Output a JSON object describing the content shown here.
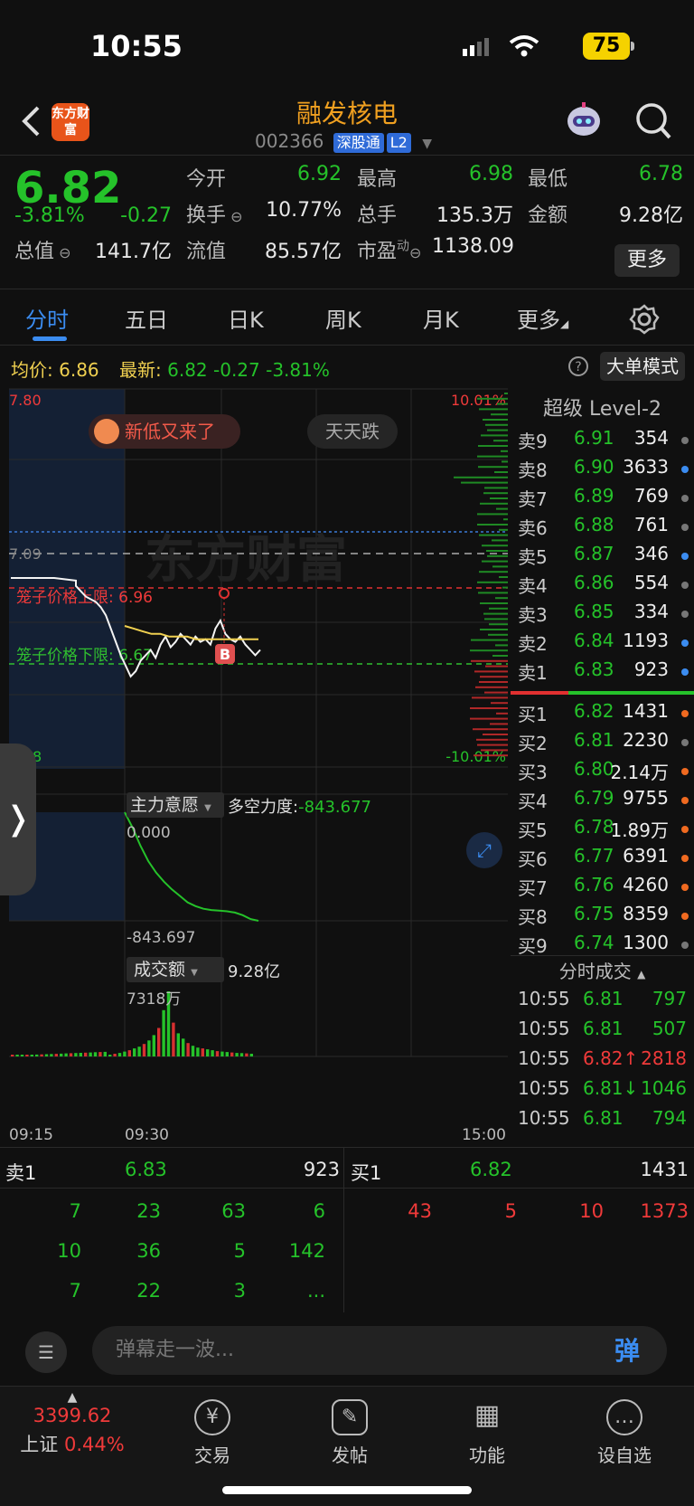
{
  "status_bar": {
    "time": "10:55",
    "battery": "75"
  },
  "header": {
    "logo_text": "东方财富",
    "stock_name": "融发核电",
    "stock_code": "002366",
    "tags": [
      "深股通",
      "L2"
    ]
  },
  "quote": {
    "price": "6.82",
    "change_pct": "-3.81%",
    "change": "-0.27",
    "rows": [
      [
        {
          "label": "今开",
          "value": "6.92",
          "color": "green"
        },
        {
          "label": "最高",
          "value": "6.98",
          "color": "green"
        },
        {
          "label": "最低",
          "value": "6.78",
          "color": "green"
        }
      ],
      [
        {
          "label": "换手",
          "value": "10.77%",
          "color": "white"
        },
        {
          "label": "总手",
          "value": "135.3万",
          "color": "white"
        },
        {
          "label": "金额",
          "value": "9.28亿",
          "color": "white"
        }
      ],
      [
        {
          "label": "总值",
          "value": "141.7亿",
          "color": "white"
        },
        {
          "label": "流值",
          "value": "85.57亿",
          "color": "white"
        },
        {
          "label": "市盈",
          "value": "1138.09",
          "color": "white"
        }
      ]
    ],
    "pe_superscript": "动",
    "more_label": "更多"
  },
  "tabs": [
    "分时",
    "五日",
    "日K",
    "周K",
    "月K",
    "更多"
  ],
  "info_line": {
    "avg_label": "均价:",
    "avg_value": "6.86",
    "latest_label": "最新:",
    "latest_value": "6.82",
    "latest_change": "-0.27",
    "latest_pct": "-3.81%",
    "bigorder_label": "大单模式"
  },
  "chart_labels": {
    "y_top": "7.80",
    "y_mid": "7.09",
    "y_bottom_partial": "8",
    "pct_top": "10.01%",
    "pct_bottom": "-10.01%",
    "badge_new_low": "新低又来了",
    "badge_daily_drop": "天天跌",
    "cage_upper": "笼子价格上限: 6.96",
    "cage_lower": "笼子价格下限: 6.67",
    "buy_marker": "B",
    "watermark": "东方财富",
    "panel2_title": "主力意愿",
    "panel2_metric_label": "多空力度:",
    "panel2_metric_value": "-843.677",
    "panel2_top": "0.000",
    "panel2_bottom": "-843.697",
    "panel3_title": "成交额",
    "panel3_value": "9.28亿",
    "panel3_top": "7318万",
    "time_labels": [
      "09:15",
      "09:30",
      "15:00"
    ]
  },
  "chart_data": {
    "type": "line",
    "title": "",
    "ylim": [
      6.38,
      7.8
    ],
    "prev_close": 7.09,
    "cage_upper": 6.96,
    "cage_lower": 6.67,
    "price": [
      7.09,
      7.09,
      7.09,
      7.08,
      7.06,
      7.04,
      7.02,
      7.01,
      7.0,
      6.98,
      6.95,
      6.9,
      6.85,
      6.8,
      6.76,
      6.72,
      6.74,
      6.78,
      6.8,
      6.82,
      6.79,
      6.84,
      6.87,
      6.83,
      6.85,
      6.88,
      6.86,
      6.84,
      6.87,
      6.85,
      6.86,
      6.84,
      6.9,
      6.93,
      6.88,
      6.86,
      6.85,
      6.87,
      6.84,
      6.82,
      6.8,
      6.82
    ],
    "avg_price": [
      6.91,
      6.9,
      6.89,
      6.88,
      6.88,
      6.87,
      6.87,
      6.87,
      6.86,
      6.86,
      6.86,
      6.86,
      6.86,
      6.86,
      6.86,
      6.86
    ],
    "main_force": [
      0,
      -120,
      -260,
      -380,
      -470,
      -540,
      -600,
      -650,
      -700,
      -730,
      -750,
      -760,
      -765,
      -770,
      -780,
      -800,
      -830,
      -843.7
    ],
    "turnover": [
      20,
      30,
      40,
      55,
      70,
      90,
      110,
      140,
      180,
      240,
      320,
      520,
      731.8,
      380,
      260,
      200,
      150,
      120,
      100,
      90,
      80,
      70,
      60,
      55,
      50,
      45,
      40,
      38,
      35,
      30
    ]
  },
  "level2": {
    "title": "超级 Level-2",
    "asks": [
      {
        "label": "卖9",
        "price": "6.91",
        "vol": "354",
        "dot": "#777"
      },
      {
        "label": "卖8",
        "price": "6.90",
        "vol": "3633",
        "dot": "#3b8cf0"
      },
      {
        "label": "卖7",
        "price": "6.89",
        "vol": "769",
        "dot": "#777"
      },
      {
        "label": "卖6",
        "price": "6.88",
        "vol": "761",
        "dot": "#777"
      },
      {
        "label": "卖5",
        "price": "6.87",
        "vol": "346",
        "dot": "#3b8cf0"
      },
      {
        "label": "卖4",
        "price": "6.86",
        "vol": "554",
        "dot": "#777"
      },
      {
        "label": "卖3",
        "price": "6.85",
        "vol": "334",
        "dot": "#777"
      },
      {
        "label": "卖2",
        "price": "6.84",
        "vol": "1193",
        "dot": "#3b8cf0"
      },
      {
        "label": "卖1",
        "price": "6.83",
        "vol": "923",
        "dot": "#3b8cf0"
      }
    ],
    "bids": [
      {
        "label": "买1",
        "price": "6.82",
        "vol": "1431",
        "dot": "#f06a20"
      },
      {
        "label": "买2",
        "price": "6.81",
        "vol": "2230",
        "dot": "#777"
      },
      {
        "label": "买3",
        "price": "6.80",
        "vol": "2.14万",
        "dot": "#f06a20"
      },
      {
        "label": "买4",
        "price": "6.79",
        "vol": "9755",
        "dot": "#f06a20"
      },
      {
        "label": "买5",
        "price": "6.78",
        "vol": "1.89万",
        "dot": "#f06a20"
      },
      {
        "label": "买6",
        "price": "6.77",
        "vol": "6391",
        "dot": "#f06a20"
      },
      {
        "label": "买7",
        "price": "6.76",
        "vol": "4260",
        "dot": "#f06a20"
      },
      {
        "label": "买8",
        "price": "6.75",
        "vol": "8359",
        "dot": "#f06a20"
      },
      {
        "label": "买9",
        "price": "6.74",
        "vol": "1300",
        "dot": "#777"
      }
    ],
    "ticks_title": "分时成交",
    "ticks": [
      {
        "time": "10:55",
        "price": "6.81",
        "vol": "797",
        "vcolor": "green"
      },
      {
        "time": "10:55",
        "price": "6.81",
        "vol": "507",
        "vcolor": "green"
      },
      {
        "time": "10:55",
        "price": "6.82↑",
        "vol": "2818",
        "vcolor": "red"
      },
      {
        "time": "10:55",
        "price": "6.81↓",
        "vol": "1046",
        "vcolor": "green"
      },
      {
        "time": "10:55",
        "price": "6.81",
        "vol": "794",
        "vcolor": "green"
      }
    ]
  },
  "depth": {
    "sell_label": "卖1",
    "sell_price": "6.83",
    "sell_vol": "923",
    "buy_label": "买1",
    "buy_price": "6.82",
    "buy_vol": "1431",
    "sell_queue": [
      [
        "7",
        "23",
        "63",
        "6"
      ],
      [
        "10",
        "36",
        "5",
        "142"
      ],
      [
        "7",
        "22",
        "3",
        "..."
      ]
    ],
    "buy_queue": [
      [
        "43",
        "5",
        "10",
        "1373"
      ]
    ]
  },
  "comment": {
    "placeholder": "弹幕走一波...",
    "danmu_label": "弹"
  },
  "nav": {
    "index_value": "3399.62",
    "index_name": "上证",
    "index_pct": "0.44%",
    "items": [
      {
        "label": "交易",
        "icon": "¥"
      },
      {
        "label": "发帖",
        "icon": "✎"
      },
      {
        "label": "功能",
        "icon": "▦"
      },
      {
        "label": "设自选",
        "icon": "…"
      }
    ]
  }
}
